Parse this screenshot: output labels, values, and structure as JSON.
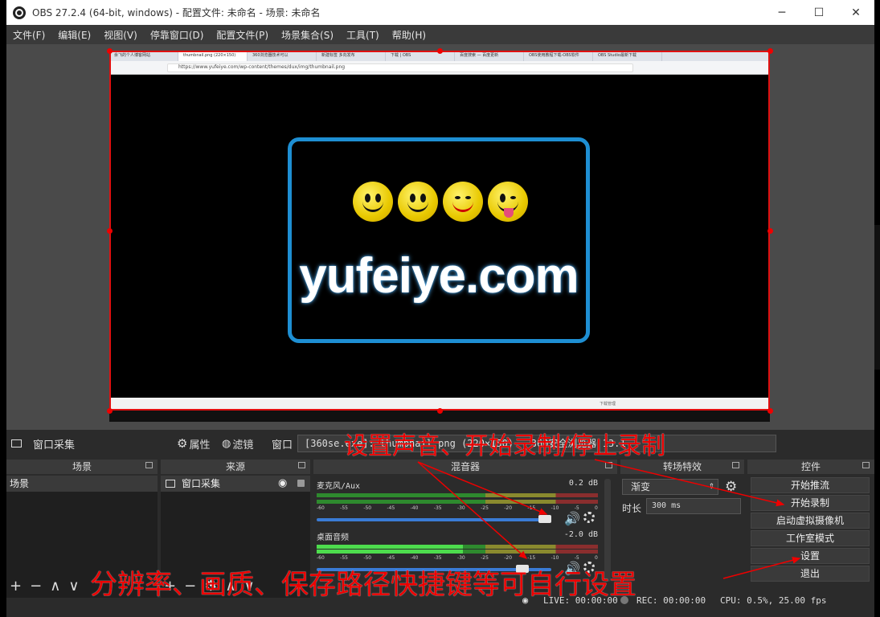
{
  "window": {
    "title": "OBS 27.2.4 (64-bit, windows) - 配置文件: 未命名 - 场景: 未命名",
    "minimize": "─",
    "maximize": "☐",
    "close": "✕"
  },
  "menu": [
    "文件(F)",
    "编辑(E)",
    "视图(V)",
    "停靠窗口(D)",
    "配置文件(P)",
    "场景集合(S)",
    "工具(T)",
    "帮助(H)"
  ],
  "browser": {
    "tabs": [
      "余飞的个人博客网站",
      "thumbnail.png (220×150)",
      "360浏览器技术可以",
      "新建标签 多向发布",
      "下载 | OBS",
      "百度搜索 — 百度更新",
      "OBS使用教程下载-OBS软件",
      "OBS Studio最新下载"
    ],
    "url": "https://www.yufeiye.com/wp-content/themes/dux/img/thumbnail.png",
    "status": "下载管理"
  },
  "logo": {
    "text": "yufeiye.com",
    "border_color": "#1e8fd3"
  },
  "source_bar": {
    "name": "窗口采集",
    "properties": "属性",
    "filters": "滤镜",
    "window_label": "窗口",
    "window_value": "[360se.exe]: thumbnail.png (220×150) - 360安全浏览器 13.1"
  },
  "docks": {
    "scenes": {
      "title": "场景",
      "items": [
        "场景"
      ]
    },
    "sources": {
      "title": "来源",
      "items": [
        "窗口采集"
      ]
    },
    "mixer": {
      "title": "混音器",
      "tracks": [
        {
          "name": "麦克风/Aux",
          "db": "0.2 dB",
          "volume": 1.0
        },
        {
          "name": "桌面音频",
          "db": "-2.0 dB",
          "volume": 0.9
        }
      ],
      "ticks": [
        "-60",
        "-55",
        "-50",
        "-45",
        "-40",
        "-35",
        "-30",
        "-25",
        "-20",
        "-15",
        "-10",
        "-5",
        "0"
      ]
    },
    "transitions": {
      "title": "转场特效",
      "type": "渐变",
      "duration_label": "时长",
      "duration": "300 ms"
    },
    "controls": {
      "title": "控件",
      "buttons": [
        "开始推流",
        "开始录制",
        "启动虚拟摄像机",
        "工作室模式",
        "设置",
        "退出"
      ]
    }
  },
  "status": {
    "live": "LIVE: 00:00:00",
    "rec": "REC: 00:00:00",
    "cpu": "CPU: 0.5%, 25.00 fps"
  },
  "annotations": {
    "top": "设置声音、开始录制/停止录制",
    "bottom": "分辨率、画质、保存路径快捷键等可自行设置",
    "color": "#e00000"
  }
}
